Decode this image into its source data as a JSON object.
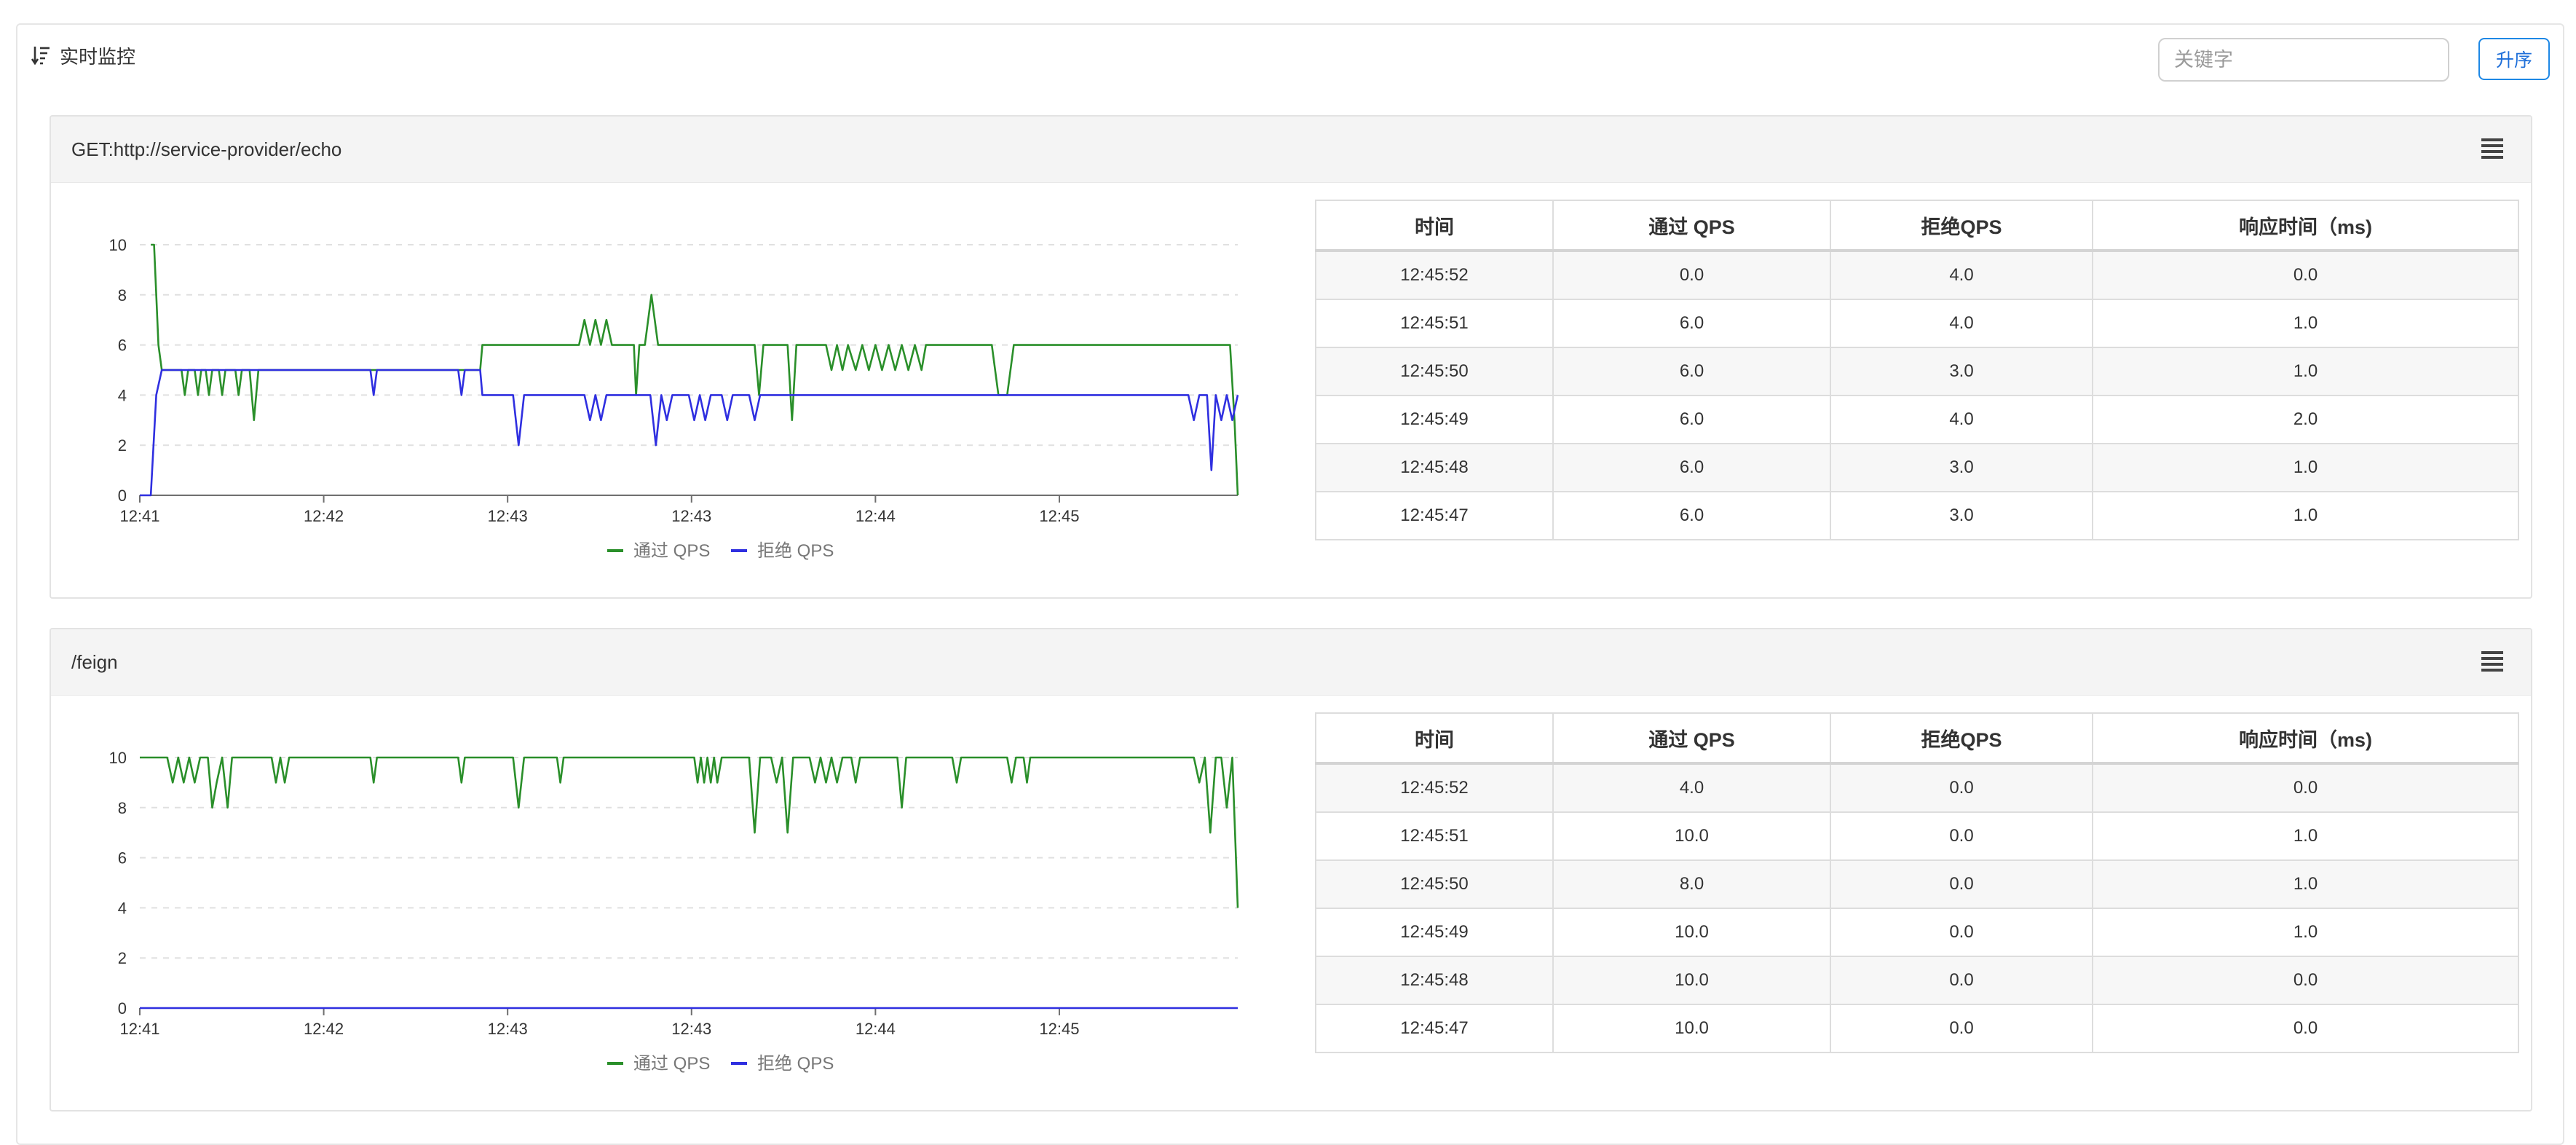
{
  "header": {
    "title": "实时监控",
    "icon": "sort-icon",
    "search_placeholder": "关键字",
    "search_value": "",
    "sort_label": "升序",
    "accent": "#1e88e5"
  },
  "table_headers": [
    "时间",
    "通过 QPS",
    "拒绝QPS",
    "响应时间（ms)"
  ],
  "colors": {
    "pass": "#2a8f2a",
    "block": "#2f2fe0",
    "grid": "#e0e0e0"
  },
  "legend": {
    "pass": "通过 QPS",
    "block": "拒绝 QPS"
  },
  "panels": [
    {
      "title": "GET:http://service-provider/echo",
      "rows": [
        [
          "12:45:52",
          "0.0",
          "4.0",
          "0.0"
        ],
        [
          "12:45:51",
          "6.0",
          "4.0",
          "1.0"
        ],
        [
          "12:45:50",
          "6.0",
          "3.0",
          "1.0"
        ],
        [
          "12:45:49",
          "6.0",
          "4.0",
          "2.0"
        ],
        [
          "12:45:48",
          "6.0",
          "3.0",
          "1.0"
        ],
        [
          "12:45:47",
          "6.0",
          "3.0",
          "1.0"
        ]
      ]
    },
    {
      "title": "/feign",
      "rows": [
        [
          "12:45:52",
          "4.0",
          "0.0",
          "0.0"
        ],
        [
          "12:45:51",
          "10.0",
          "0.0",
          "1.0"
        ],
        [
          "12:45:50",
          "8.0",
          "0.0",
          "1.0"
        ],
        [
          "12:45:49",
          "10.0",
          "0.0",
          "1.0"
        ],
        [
          "12:45:48",
          "10.0",
          "0.0",
          "0.0"
        ],
        [
          "12:45:47",
          "10.0",
          "0.0",
          "0.0"
        ]
      ]
    }
  ],
  "chart_data": [
    {
      "type": "line",
      "ylim": [
        0,
        10
      ],
      "yticks": [
        "0",
        "2",
        "4",
        "6",
        "8",
        "10"
      ],
      "xticks": [
        "12:41",
        "12:42",
        "12:43",
        "12:43",
        "12:44",
        "12:45"
      ],
      "series": [
        {
          "name": "通过 QPS",
          "color": "#2a8f2a",
          "points": [
            [
              0.01,
              10
            ],
            [
              0.013,
              10
            ],
            [
              0.017,
              6
            ],
            [
              0.02,
              5
            ],
            [
              0.038,
              5
            ],
            [
              0.041,
              4
            ],
            [
              0.044,
              5
            ],
            [
              0.05,
              5
            ],
            [
              0.053,
              4
            ],
            [
              0.056,
              5
            ],
            [
              0.06,
              5
            ],
            [
              0.063,
              4
            ],
            [
              0.066,
              5
            ],
            [
              0.072,
              5
            ],
            [
              0.075,
              4
            ],
            [
              0.078,
              5
            ],
            [
              0.087,
              5
            ],
            [
              0.09,
              4
            ],
            [
              0.093,
              5
            ],
            [
              0.1,
              5
            ],
            [
              0.104,
              3
            ],
            [
              0.108,
              5
            ],
            [
              0.31,
              5
            ],
            [
              0.312,
              6
            ],
            [
              0.4,
              6
            ],
            [
              0.405,
              7
            ],
            [
              0.41,
              6
            ],
            [
              0.415,
              7
            ],
            [
              0.42,
              6
            ],
            [
              0.425,
              7
            ],
            [
              0.43,
              6
            ],
            [
              0.45,
              6
            ],
            [
              0.452,
              4
            ],
            [
              0.455,
              6
            ],
            [
              0.46,
              6
            ],
            [
              0.466,
              8
            ],
            [
              0.472,
              6
            ],
            [
              0.56,
              6
            ],
            [
              0.564,
              4
            ],
            [
              0.568,
              6
            ],
            [
              0.59,
              6
            ],
            [
              0.594,
              3
            ],
            [
              0.598,
              6
            ],
            [
              0.625,
              6
            ],
            [
              0.63,
              5
            ],
            [
              0.635,
              6
            ],
            [
              0.64,
              5
            ],
            [
              0.645,
              6
            ],
            [
              0.652,
              5
            ],
            [
              0.658,
              6
            ],
            [
              0.664,
              5
            ],
            [
              0.67,
              6
            ],
            [
              0.676,
              5
            ],
            [
              0.682,
              6
            ],
            [
              0.688,
              5
            ],
            [
              0.694,
              6
            ],
            [
              0.7,
              5
            ],
            [
              0.706,
              6
            ],
            [
              0.712,
              5
            ],
            [
              0.716,
              6
            ],
            [
              0.776,
              6
            ],
            [
              0.782,
              4
            ],
            [
              0.79,
              4
            ],
            [
              0.796,
              6
            ],
            [
              0.993,
              6
            ],
            [
              0.997,
              3
            ],
            [
              1.0,
              0
            ]
          ]
        },
        {
          "name": "拒绝 QPS",
          "color": "#2f2fe0",
          "points": [
            [
              0.0,
              0
            ],
            [
              0.01,
              0
            ],
            [
              0.015,
              4
            ],
            [
              0.02,
              5
            ],
            [
              0.21,
              5
            ],
            [
              0.213,
              4
            ],
            [
              0.216,
              5
            ],
            [
              0.29,
              5
            ],
            [
              0.293,
              4
            ],
            [
              0.296,
              5
            ],
            [
              0.31,
              5
            ],
            [
              0.312,
              4
            ],
            [
              0.34,
              4
            ],
            [
              0.345,
              2
            ],
            [
              0.35,
              4
            ],
            [
              0.405,
              4
            ],
            [
              0.41,
              3
            ],
            [
              0.415,
              4
            ],
            [
              0.42,
              3
            ],
            [
              0.425,
              4
            ],
            [
              0.465,
              4
            ],
            [
              0.47,
              2
            ],
            [
              0.475,
              4
            ],
            [
              0.48,
              3
            ],
            [
              0.485,
              4
            ],
            [
              0.5,
              4
            ],
            [
              0.505,
              3
            ],
            [
              0.51,
              4
            ],
            [
              0.515,
              3
            ],
            [
              0.52,
              4
            ],
            [
              0.53,
              4
            ],
            [
              0.535,
              3
            ],
            [
              0.54,
              4
            ],
            [
              0.555,
              4
            ],
            [
              0.56,
              3
            ],
            [
              0.565,
              4
            ],
            [
              0.955,
              4
            ],
            [
              0.96,
              3
            ],
            [
              0.965,
              4
            ],
            [
              0.972,
              4
            ],
            [
              0.976,
              1
            ],
            [
              0.98,
              4
            ],
            [
              0.985,
              3
            ],
            [
              0.99,
              4
            ],
            [
              0.995,
              3
            ],
            [
              1.0,
              4
            ]
          ]
        }
      ]
    },
    {
      "type": "line",
      "ylim": [
        0,
        10
      ],
      "yticks": [
        "0",
        "2",
        "4",
        "6",
        "8",
        "10"
      ],
      "xticks": [
        "12:41",
        "12:42",
        "12:43",
        "12:43",
        "12:44",
        "12:45"
      ],
      "series": [
        {
          "name": "通过 QPS",
          "color": "#2a8f2a",
          "points": [
            [
              0.0,
              10
            ],
            [
              0.025,
              10
            ],
            [
              0.03,
              9
            ],
            [
              0.035,
              10
            ],
            [
              0.04,
              9
            ],
            [
              0.045,
              10
            ],
            [
              0.05,
              9
            ],
            [
              0.055,
              10
            ],
            [
              0.062,
              10
            ],
            [
              0.066,
              8
            ],
            [
              0.07,
              9
            ],
            [
              0.075,
              10
            ],
            [
              0.08,
              8
            ],
            [
              0.084,
              10
            ],
            [
              0.12,
              10
            ],
            [
              0.124,
              9
            ],
            [
              0.128,
              10
            ],
            [
              0.132,
              9
            ],
            [
              0.136,
              10
            ],
            [
              0.21,
              10
            ],
            [
              0.213,
              9
            ],
            [
              0.216,
              10
            ],
            [
              0.29,
              10
            ],
            [
              0.293,
              9
            ],
            [
              0.296,
              10
            ],
            [
              0.34,
              10
            ],
            [
              0.345,
              8
            ],
            [
              0.35,
              10
            ],
            [
              0.38,
              10
            ],
            [
              0.383,
              9
            ],
            [
              0.386,
              10
            ],
            [
              0.505,
              10
            ],
            [
              0.508,
              9
            ],
            [
              0.511,
              10
            ],
            [
              0.514,
              9
            ],
            [
              0.517,
              10
            ],
            [
              0.52,
              9
            ],
            [
              0.523,
              10
            ],
            [
              0.526,
              9
            ],
            [
              0.53,
              10
            ],
            [
              0.555,
              10
            ],
            [
              0.56,
              7
            ],
            [
              0.565,
              10
            ],
            [
              0.575,
              10
            ],
            [
              0.58,
              9
            ],
            [
              0.585,
              10
            ],
            [
              0.59,
              7
            ],
            [
              0.595,
              10
            ],
            [
              0.61,
              10
            ],
            [
              0.615,
              9
            ],
            [
              0.62,
              10
            ],
            [
              0.625,
              9
            ],
            [
              0.63,
              10
            ],
            [
              0.635,
              9
            ],
            [
              0.64,
              10
            ],
            [
              0.648,
              10
            ],
            [
              0.652,
              9
            ],
            [
              0.656,
              10
            ],
            [
              0.69,
              10
            ],
            [
              0.694,
              8
            ],
            [
              0.698,
              10
            ],
            [
              0.74,
              10
            ],
            [
              0.744,
              9
            ],
            [
              0.748,
              10
            ],
            [
              0.79,
              10
            ],
            [
              0.794,
              9
            ],
            [
              0.798,
              10
            ],
            [
              0.805,
              10
            ],
            [
              0.808,
              9
            ],
            [
              0.811,
              10
            ],
            [
              0.96,
              10
            ],
            [
              0.965,
              9
            ],
            [
              0.97,
              10
            ],
            [
              0.975,
              7
            ],
            [
              0.98,
              10
            ],
            [
              0.985,
              10
            ],
            [
              0.99,
              8
            ],
            [
              0.995,
              10
            ],
            [
              1.0,
              4
            ]
          ]
        },
        {
          "name": "拒绝 QPS",
          "color": "#2f2fe0",
          "points": [
            [
              0.0,
              0
            ],
            [
              1.0,
              0
            ]
          ]
        }
      ]
    }
  ]
}
